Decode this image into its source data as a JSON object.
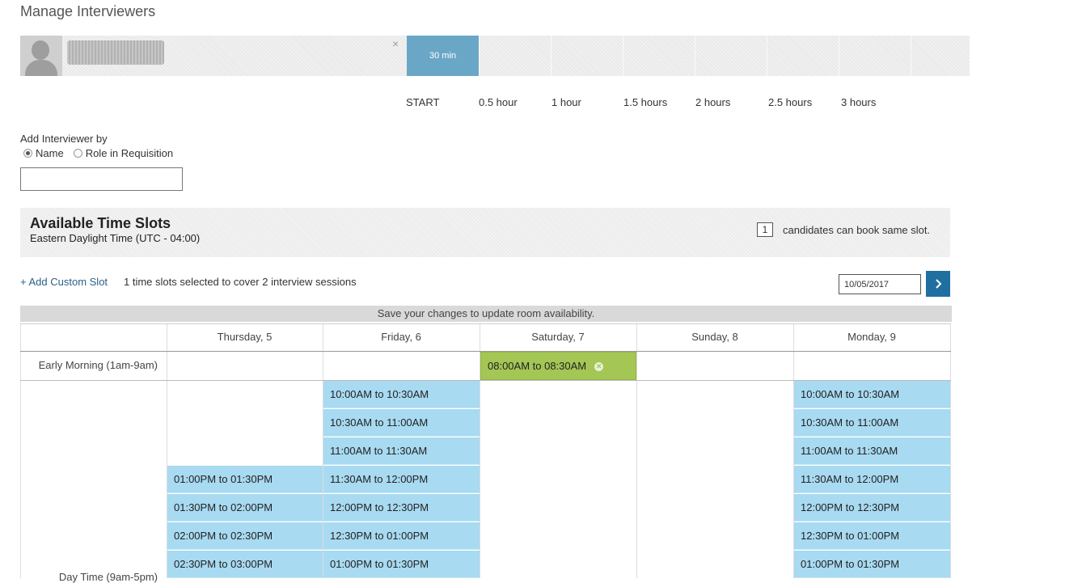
{
  "page": {
    "title": "Manage Interviewers"
  },
  "interviewer_strip": {
    "slot_label": "30 min",
    "close_glyph": "×",
    "scale": [
      "START",
      "0.5 hour",
      "1 hour",
      "1.5 hours",
      "2 hours",
      "2.5 hours",
      "3 hours"
    ]
  },
  "add_interviewer": {
    "label": "Add Interviewer by",
    "options": [
      {
        "label": "Name",
        "selected": true
      },
      {
        "label": "Role in Requisition",
        "selected": false
      }
    ],
    "input_value": ""
  },
  "available": {
    "title": "Available Time Slots",
    "timezone": "Eastern Daylight Time (UTC - 04:00)",
    "capacity_value": "1",
    "capacity_text": "candidates can book same slot."
  },
  "toolbar": {
    "add_custom_slot": "+ Add Custom Slot",
    "selection_info": "1 time slots selected to cover 2 interview sessions",
    "date_value": "10/05/2017",
    "next_icon": "chevron-right-icon"
  },
  "save_notice": "Save your changes to update room availability.",
  "calendar": {
    "days": [
      "Thursday, 5",
      "Friday, 6",
      "Saturday, 7",
      "Sunday, 8",
      "Monday, 9"
    ],
    "rows": {
      "early": "Early Morning (1am-9am)",
      "day": "Day Time (9am-5pm)"
    },
    "early_slot": {
      "day": "Saturday, 7",
      "label": "08:00AM to 08:30AM",
      "status": "selected"
    },
    "thursday": [
      "01:00PM to 01:30PM",
      "01:30PM to 02:00PM",
      "02:00PM to 02:30PM",
      "02:30PM to 03:00PM"
    ],
    "friday": [
      "10:00AM to 10:30AM",
      "10:30AM to 11:00AM",
      "11:00AM to 11:30AM",
      "11:30AM to 12:00PM",
      "12:00PM to 12:30PM",
      "12:30PM to 01:00PM",
      "01:00PM to 01:30PM"
    ],
    "monday": [
      "10:00AM to 10:30AM",
      "10:30AM to 11:00AM",
      "11:00AM to 11:30AM",
      "11:30AM to 12:00PM",
      "12:00PM to 12:30PM",
      "12:30PM to 01:00PM",
      "01:00PM to 01:30PM"
    ]
  },
  "colors": {
    "slot_blue": "#a8daf1",
    "slot_green": "#a3c655",
    "accent": "#1f6fa1",
    "strip_slot": "#6aa7c6"
  }
}
